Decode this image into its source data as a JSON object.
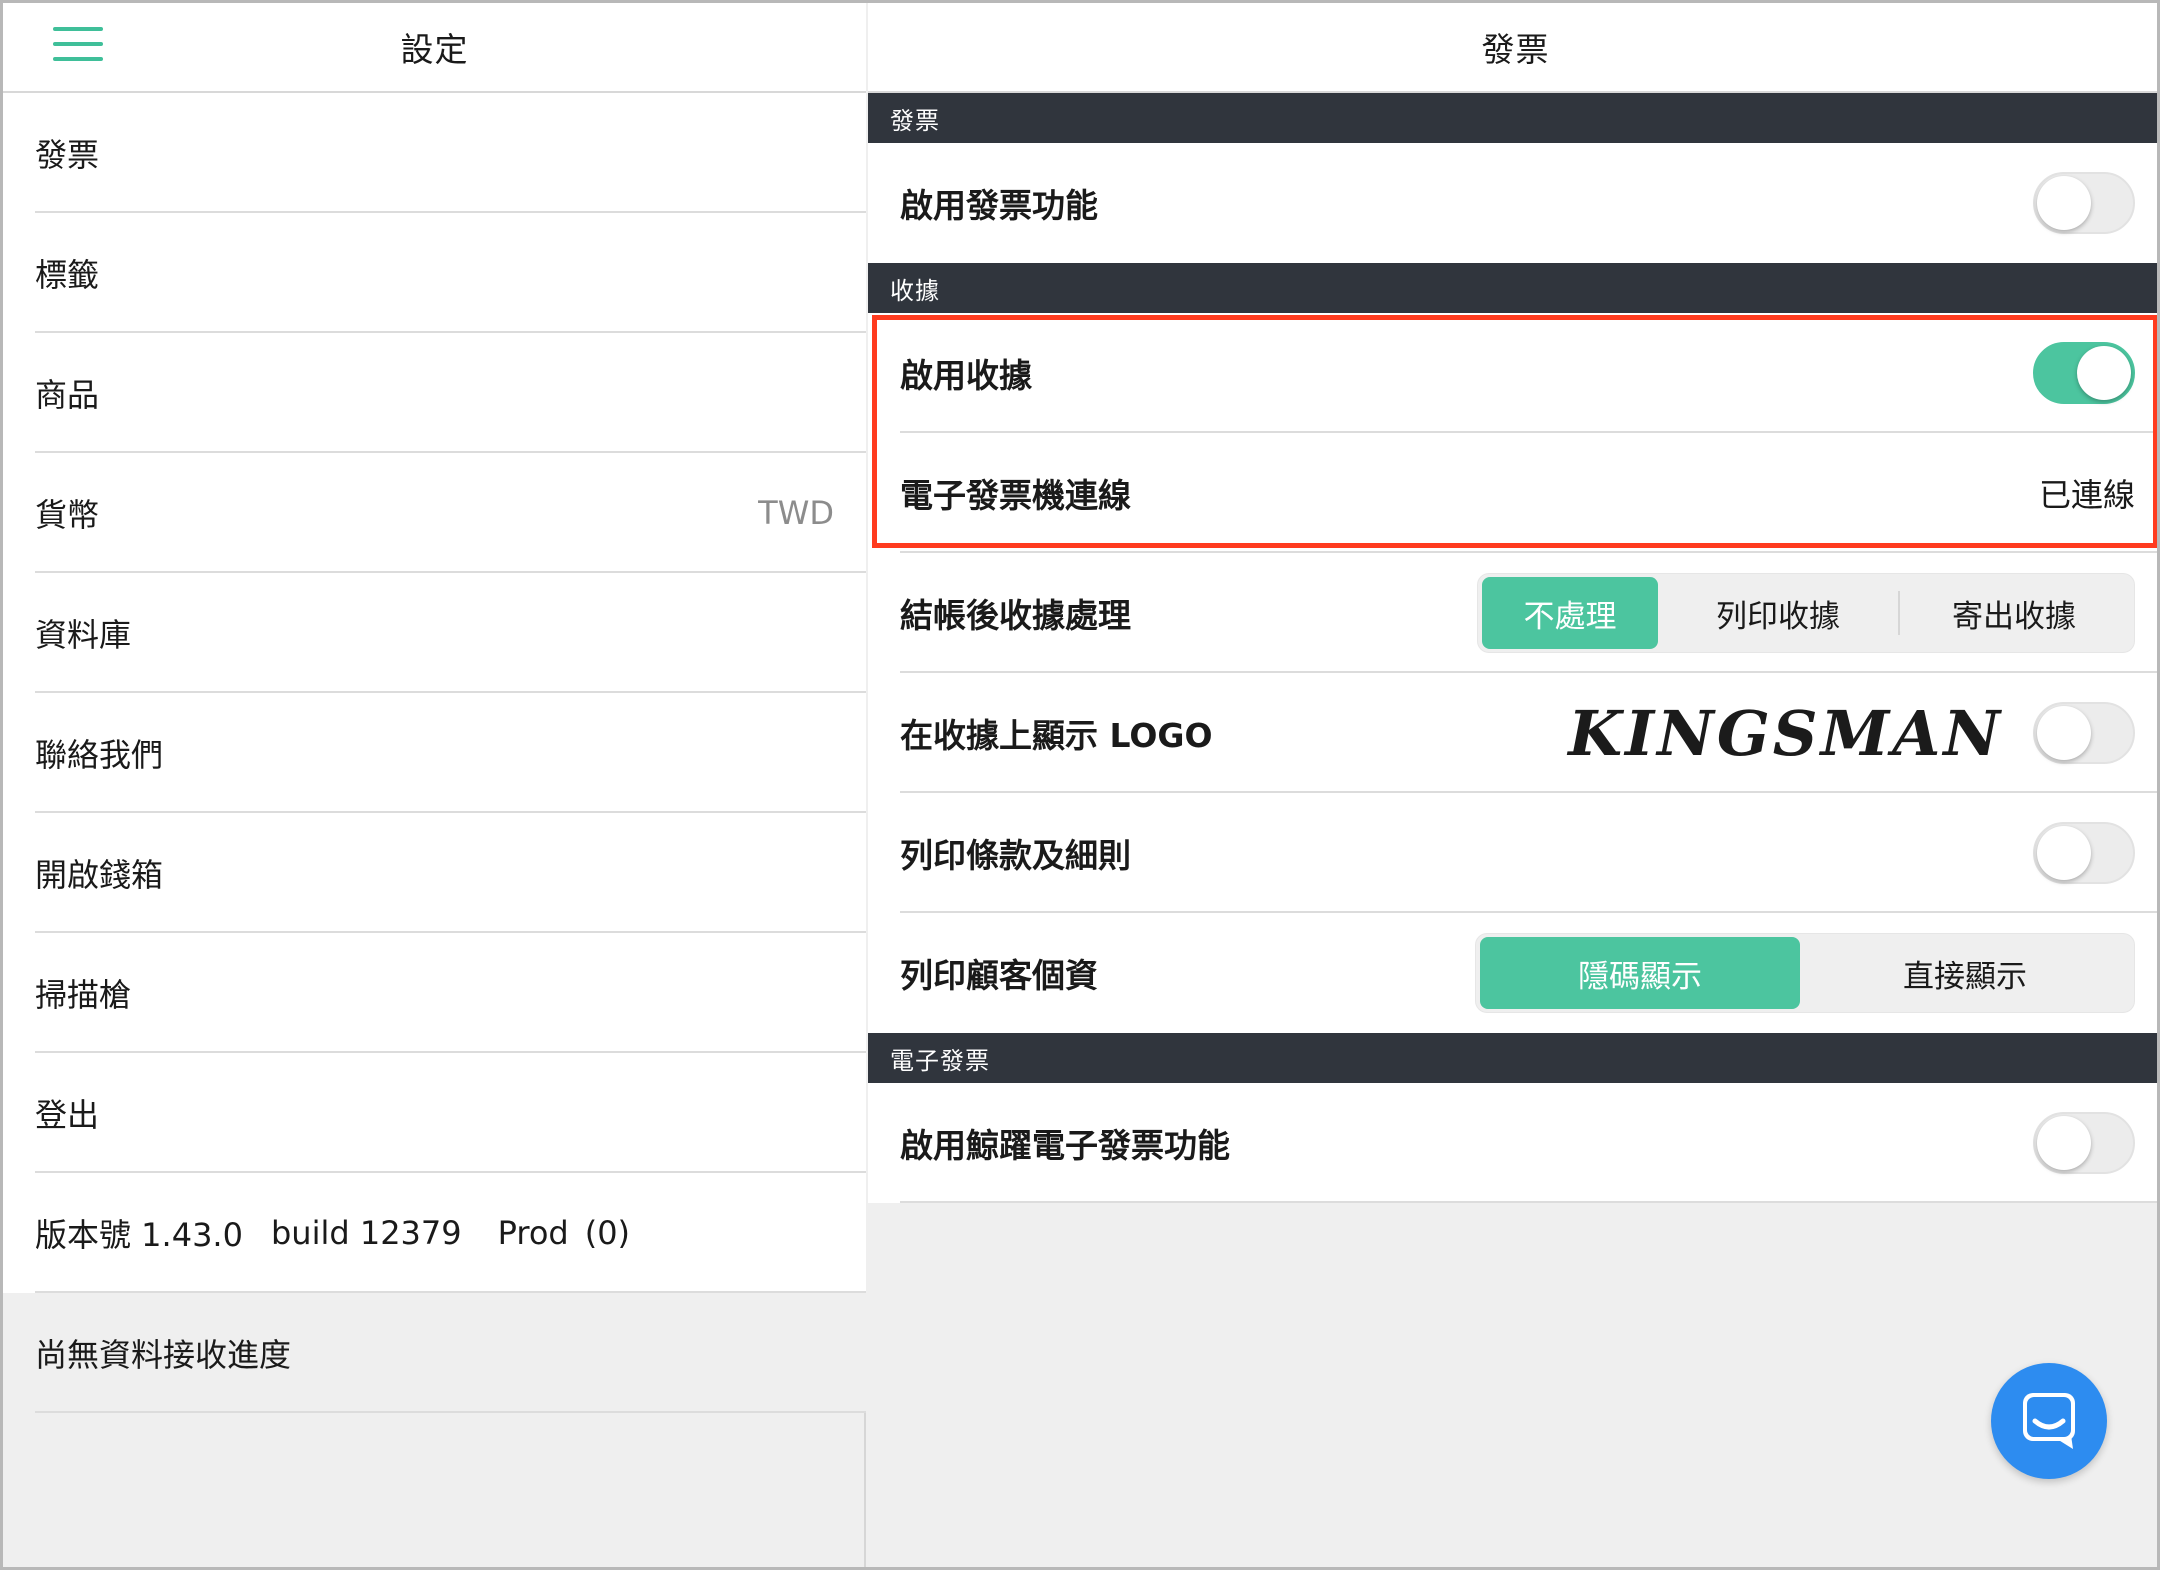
{
  "left_pane": {
    "title": "設定",
    "items": [
      {
        "label": "發票",
        "value": ""
      },
      {
        "label": "標籤",
        "value": ""
      },
      {
        "label": "商品",
        "value": ""
      },
      {
        "label": "貨幣",
        "value": "TWD"
      },
      {
        "label": "資料庫",
        "value": ""
      },
      {
        "label": "聯絡我們",
        "value": ""
      },
      {
        "label": "開啟錢箱",
        "value": ""
      },
      {
        "label": "掃描槍",
        "value": ""
      },
      {
        "label": "登出",
        "value": ""
      }
    ],
    "version": {
      "number": "版本號 1.43.0",
      "build": "build 12379",
      "env": "Prod",
      "count": "(0)"
    },
    "sync_status": "尚無資料接收進度"
  },
  "right_pane": {
    "title": "發票",
    "sections": {
      "invoice": {
        "header": "發票",
        "enable_invoice": {
          "label": "啟用發票功能",
          "enabled": false
        }
      },
      "receipt": {
        "header": "收據",
        "enable_receipt": {
          "label": "啟用收據",
          "enabled": true
        },
        "einvoice_connection": {
          "label": "電子發票機連線",
          "status": "已連線"
        },
        "after_checkout": {
          "label": "結帳後收據處理",
          "options": [
            "不處理",
            "列印收據",
            "寄出收據"
          ],
          "selected": "不處理"
        },
        "show_logo": {
          "label": "在收據上顯示 LOGO",
          "logo_text": "KINGSMAN",
          "enabled": false
        },
        "print_terms": {
          "label": "列印條款及細則",
          "enabled": false
        },
        "print_customer": {
          "label": "列印顧客個資",
          "options": [
            "隱碼顯示",
            "直接顯示"
          ],
          "selected": "隱碼顯示"
        }
      },
      "einvoice": {
        "header": "電子發票",
        "enable_whale": {
          "label": "啟用鯨躍電子發票功能",
          "enabled": false
        }
      }
    }
  },
  "colors": {
    "accent": "#4cc59f",
    "highlight": "#ff3b1f",
    "section_header": "#30353d",
    "chat": "#2d8cf0"
  },
  "icons": {
    "menu": "hamburger-menu-icon",
    "chat": "chat-bubble-icon"
  }
}
